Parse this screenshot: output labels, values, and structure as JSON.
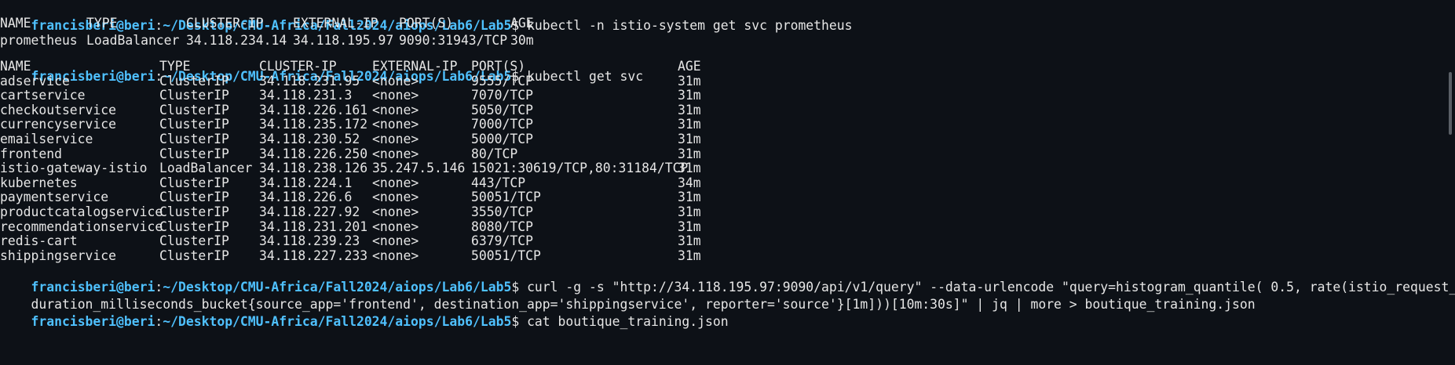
{
  "terminal": {
    "prompt": {
      "user": "francisberi@beri",
      "sep": ":",
      "path": "~/Desktop/CMU-Africa/Fall2024/aiops/Lab6/Lab5",
      "symbol": "$"
    },
    "cmd1": "kubectl -n istio-system get svc prometheus",
    "table1": {
      "headers": [
        "NAME",
        "TYPE",
        "CLUSTER-IP",
        "EXTERNAL-IP",
        "PORT(S)",
        "AGE"
      ],
      "rows": [
        [
          "prometheus",
          "LoadBalancer",
          "34.118.234.14",
          "34.118.195.97",
          "9090:31943/TCP",
          "30m"
        ]
      ]
    },
    "cmd2": "kubectl get svc",
    "table2": {
      "headers": [
        "NAME",
        "TYPE",
        "CLUSTER-IP",
        "EXTERNAL-IP",
        "PORT(S)",
        "AGE"
      ],
      "rows": [
        [
          "adservice",
          "ClusterIP",
          "34.118.231.95",
          "<none>",
          "9555/TCP",
          "31m"
        ],
        [
          "cartservice",
          "ClusterIP",
          "34.118.231.3",
          "<none>",
          "7070/TCP",
          "31m"
        ],
        [
          "checkoutservice",
          "ClusterIP",
          "34.118.226.161",
          "<none>",
          "5050/TCP",
          "31m"
        ],
        [
          "currencyservice",
          "ClusterIP",
          "34.118.235.172",
          "<none>",
          "7000/TCP",
          "31m"
        ],
        [
          "emailservice",
          "ClusterIP",
          "34.118.230.52",
          "<none>",
          "5000/TCP",
          "31m"
        ],
        [
          "frontend",
          "ClusterIP",
          "34.118.226.250",
          "<none>",
          "80/TCP",
          "31m"
        ],
        [
          "istio-gateway-istio",
          "LoadBalancer",
          "34.118.238.126",
          "35.247.5.146",
          "15021:30619/TCP,80:31184/TCP",
          "31m"
        ],
        [
          "kubernetes",
          "ClusterIP",
          "34.118.224.1",
          "<none>",
          "443/TCP",
          "34m"
        ],
        [
          "paymentservice",
          "ClusterIP",
          "34.118.226.6",
          "<none>",
          "50051/TCP",
          "31m"
        ],
        [
          "productcatalogservice",
          "ClusterIP",
          "34.118.227.92",
          "<none>",
          "3550/TCP",
          "31m"
        ],
        [
          "recommendationservice",
          "ClusterIP",
          "34.118.231.201",
          "<none>",
          "8080/TCP",
          "31m"
        ],
        [
          "redis-cart",
          "ClusterIP",
          "34.118.239.23",
          "<none>",
          "6379/TCP",
          "31m"
        ],
        [
          "shippingservice",
          "ClusterIP",
          "34.118.227.233",
          "<none>",
          "50051/TCP",
          "31m"
        ]
      ]
    },
    "cmd3_line1": "curl -g -s \"http://34.118.195.97:9090/api/v1/query\" --data-urlencode \"query=histogram_quantile( 0.5, rate(istio_request_",
    "cmd3_line2": "duration_milliseconds_bucket{source_app='frontend', destination_app='shippingservice', reporter='source'}[1m]))[10m:30s]\" | jq | more > boutique_training.json",
    "cmd4": "cat boutique_training.json",
    "colors": {
      "background": "#0d1117",
      "prompt": "#4fc1ff",
      "text": "#e6e6e6"
    }
  }
}
